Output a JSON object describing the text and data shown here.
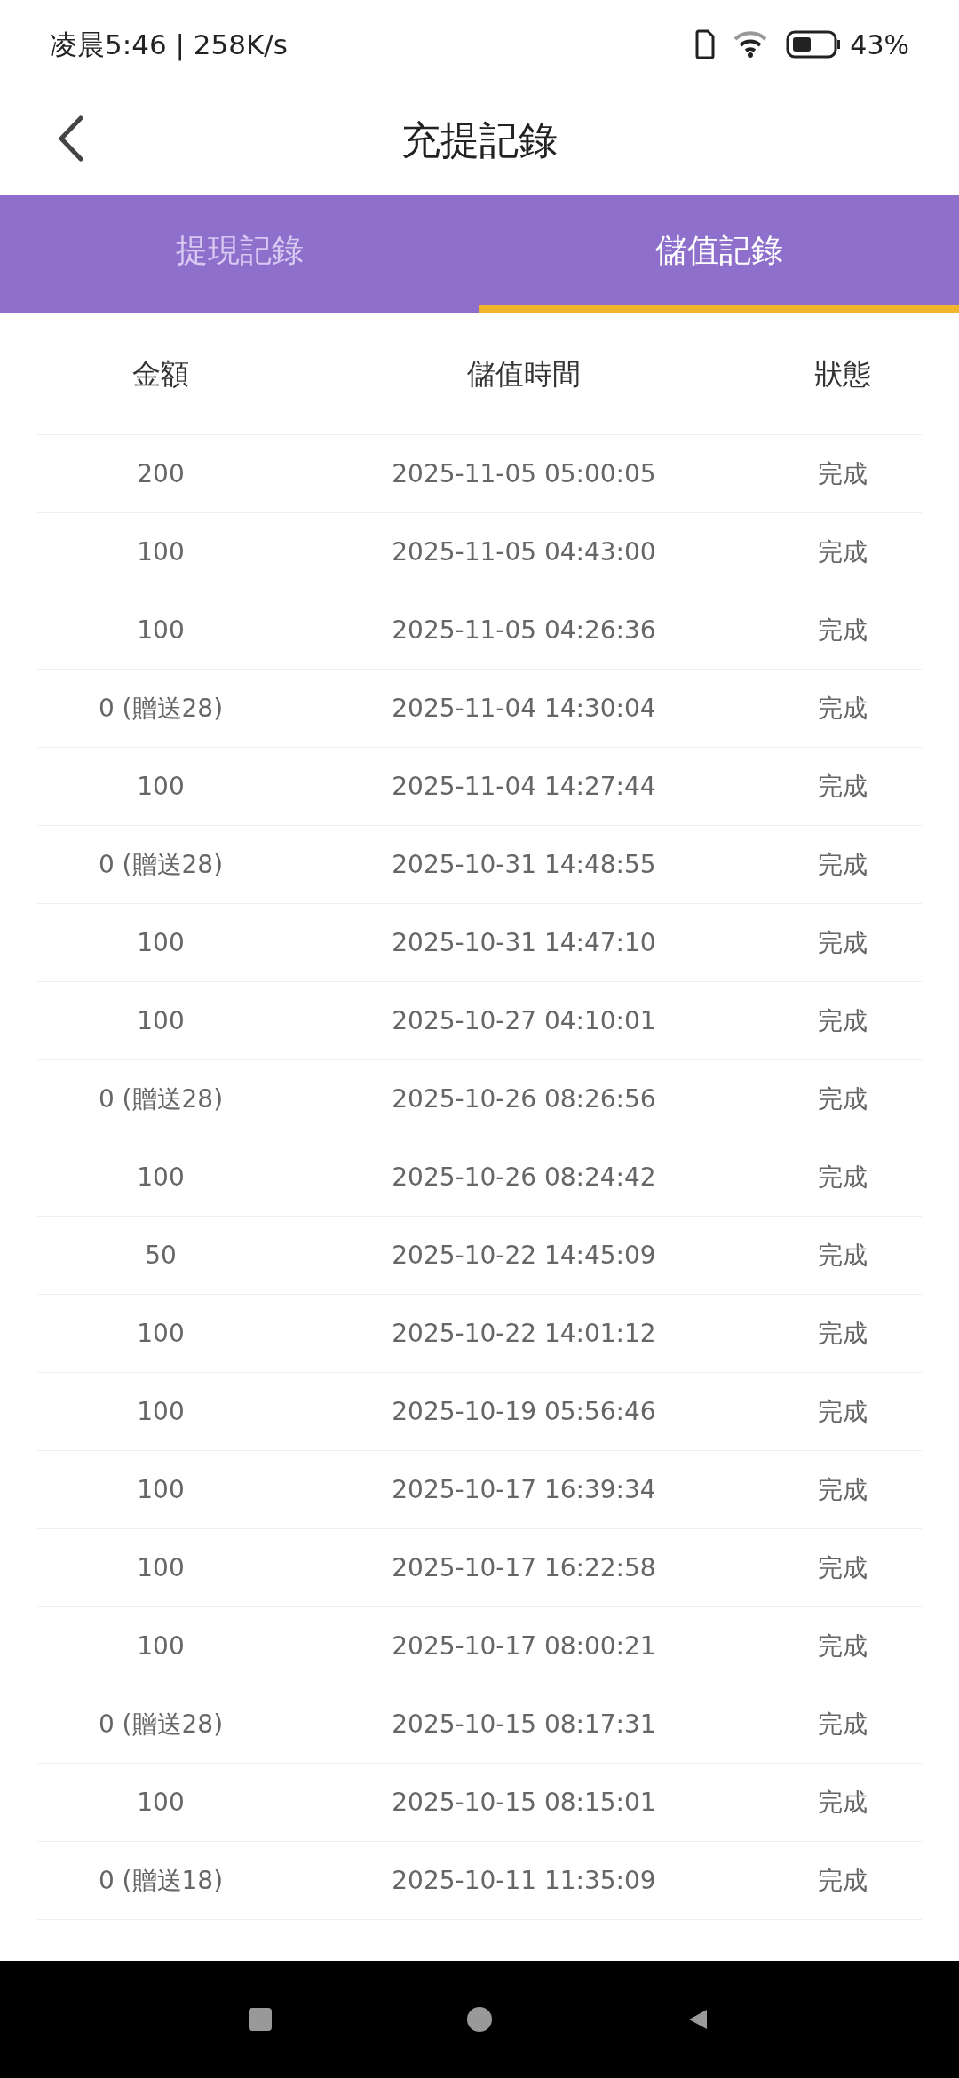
{
  "status_bar": {
    "time": "凌晨5:46 | 258K/s",
    "battery_percent": "43%"
  },
  "header": {
    "title": "充提記錄"
  },
  "tabs": [
    {
      "label": "提現記錄",
      "selected": false
    },
    {
      "label": "儲值記錄",
      "selected": true
    }
  ],
  "table": {
    "columns": [
      "金額",
      "儲值時間",
      "狀態"
    ],
    "rows": [
      {
        "amount": "200",
        "time": "2025-11-05 05:00:05",
        "status": "完成"
      },
      {
        "amount": "100",
        "time": "2025-11-05 04:43:00",
        "status": "完成"
      },
      {
        "amount": "100",
        "time": "2025-11-05 04:26:36",
        "status": "完成"
      },
      {
        "amount": "0 (贈送28)",
        "time": "2025-11-04 14:30:04",
        "status": "完成"
      },
      {
        "amount": "100",
        "time": "2025-11-04 14:27:44",
        "status": "完成"
      },
      {
        "amount": "0 (贈送28)",
        "time": "2025-10-31 14:48:55",
        "status": "完成"
      },
      {
        "amount": "100",
        "time": "2025-10-31 14:47:10",
        "status": "完成"
      },
      {
        "amount": "100",
        "time": "2025-10-27 04:10:01",
        "status": "完成"
      },
      {
        "amount": "0 (贈送28)",
        "time": "2025-10-26 08:26:56",
        "status": "完成"
      },
      {
        "amount": "100",
        "time": "2025-10-26 08:24:42",
        "status": "完成"
      },
      {
        "amount": "50",
        "time": "2025-10-22 14:45:09",
        "status": "完成"
      },
      {
        "amount": "100",
        "time": "2025-10-22 14:01:12",
        "status": "完成"
      },
      {
        "amount": "100",
        "time": "2025-10-19 05:56:46",
        "status": "完成"
      },
      {
        "amount": "100",
        "time": "2025-10-17 16:39:34",
        "status": "完成"
      },
      {
        "amount": "100",
        "time": "2025-10-17 16:22:58",
        "status": "完成"
      },
      {
        "amount": "100",
        "time": "2025-10-17 08:00:21",
        "status": "完成"
      },
      {
        "amount": "0 (贈送28)",
        "time": "2025-10-15 08:17:31",
        "status": "完成"
      },
      {
        "amount": "100",
        "time": "2025-10-15 08:15:01",
        "status": "完成"
      },
      {
        "amount": "0 (贈送18)",
        "time": "2025-10-11 11:35:09",
        "status": "完成"
      }
    ]
  }
}
